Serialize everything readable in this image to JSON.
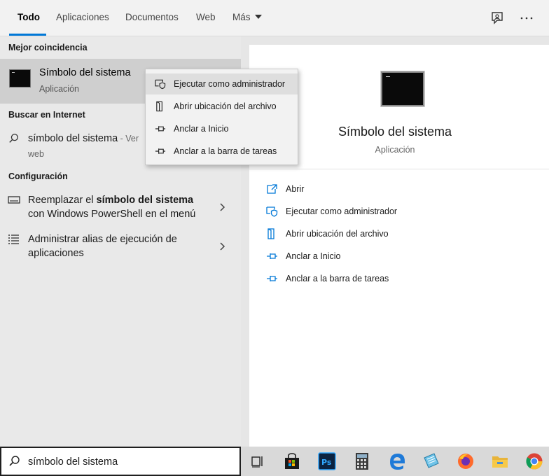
{
  "tabs": [
    {
      "label": "Todo"
    },
    {
      "label": "Aplicaciones"
    },
    {
      "label": "Documentos"
    },
    {
      "label": "Web"
    },
    {
      "label": "Más"
    }
  ],
  "top_icons": [
    "feedback-icon",
    "more-options-icon"
  ],
  "sections": {
    "best_match": "Mejor coincidencia",
    "internet": "Buscar en Internet",
    "settings": "Configuración"
  },
  "best_match": {
    "title": "Símbolo del sistema",
    "subtitle": "Aplicación",
    "icon": "command-prompt-icon"
  },
  "internet_result": {
    "query": "símbolo del sistema",
    "suffix": " - Ver",
    "line2": "web"
  },
  "settings_results": [
    {
      "pre": "Reemplazar el ",
      "bold": "símbolo del sistema",
      "line2": "con Windows PowerShell en el menú"
    },
    {
      "line1": "Administrar alias de ejecución de",
      "line2": "aplicaciones"
    }
  ],
  "context_menu": [
    {
      "label": "Ejecutar como administrador",
      "icon": "shield-run-icon"
    },
    {
      "label": "Abrir ubicación del archivo",
      "icon": "file-location-icon"
    },
    {
      "label": "Anclar a Inicio",
      "icon": "pin-icon"
    },
    {
      "label": "Anclar a la barra de tareas",
      "icon": "pin-icon"
    }
  ],
  "preview": {
    "title": "Símbolo del sistema",
    "subtitle": "Aplicación",
    "actions": [
      {
        "label": "Abrir",
        "icon": "open-icon"
      },
      {
        "label": "Ejecutar como administrador",
        "icon": "shield-run-icon"
      },
      {
        "label": "Abrir ubicación del archivo",
        "icon": "file-location-icon"
      },
      {
        "label": "Anclar a Inicio",
        "icon": "pin-icon"
      },
      {
        "label": "Anclar a la barra de tareas",
        "icon": "pin-icon"
      }
    ]
  },
  "search": {
    "value": "símbolo del sistema"
  },
  "taskbar_icons": [
    "task-view-icon",
    "store-icon",
    "photoshop-icon",
    "calculator-icon",
    "edge-icon",
    "notepad-icon",
    "firefox-icon",
    "file-explorer-icon",
    "chrome-icon"
  ],
  "colors": {
    "accent": "#0078d7",
    "action_icon": "#0078d7"
  }
}
